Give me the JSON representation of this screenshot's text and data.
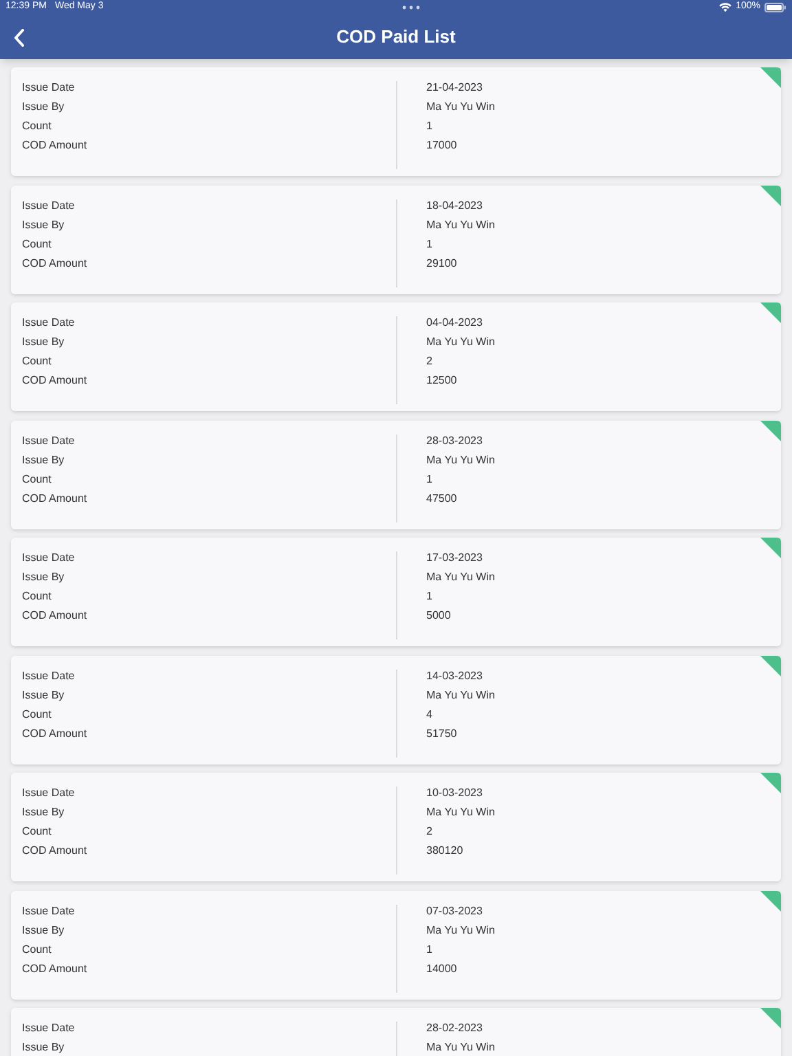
{
  "status_bar": {
    "time": "12:39 PM",
    "date": "Wed May 3",
    "battery": "100%"
  },
  "header": {
    "title": "COD Paid List"
  },
  "cards": [
    {
      "fields": [
        {
          "label": "Issue Date",
          "value": "21-04-2023"
        },
        {
          "label": "Issue By",
          "value": "Ma Yu Yu Win"
        },
        {
          "label": "Count",
          "value": "1"
        },
        {
          "label": "COD Amount",
          "value": "17000"
        }
      ]
    },
    {
      "fields": [
        {
          "label": "Issue Date",
          "value": "18-04-2023"
        },
        {
          "label": "Issue By",
          "value": "Ma Yu Yu Win"
        },
        {
          "label": "Count",
          "value": "1"
        },
        {
          "label": "COD Amount",
          "value": "29100"
        }
      ]
    },
    {
      "fields": [
        {
          "label": "Issue Date",
          "value": "04-04-2023"
        },
        {
          "label": "Issue By",
          "value": "Ma Yu Yu Win"
        },
        {
          "label": "Count",
          "value": "2"
        },
        {
          "label": "COD Amount",
          "value": "12500"
        }
      ]
    },
    {
      "fields": [
        {
          "label": "Issue Date",
          "value": "28-03-2023"
        },
        {
          "label": "Issue By",
          "value": "Ma Yu Yu Win"
        },
        {
          "label": "Count",
          "value": "1"
        },
        {
          "label": "COD Amount",
          "value": "47500"
        }
      ]
    },
    {
      "fields": [
        {
          "label": "Issue Date",
          "value": "17-03-2023"
        },
        {
          "label": "Issue By",
          "value": "Ma Yu Yu Win"
        },
        {
          "label": "Count",
          "value": "1"
        },
        {
          "label": "COD Amount",
          "value": "5000"
        }
      ]
    },
    {
      "fields": [
        {
          "label": "Issue Date",
          "value": "14-03-2023"
        },
        {
          "label": "Issue By",
          "value": "Ma Yu Yu Win"
        },
        {
          "label": "Count",
          "value": "4"
        },
        {
          "label": "COD Amount",
          "value": "51750"
        }
      ]
    },
    {
      "fields": [
        {
          "label": "Issue Date",
          "value": "10-03-2023"
        },
        {
          "label": "Issue By",
          "value": "Ma Yu Yu Win"
        },
        {
          "label": "Count",
          "value": "2"
        },
        {
          "label": "COD Amount",
          "value": "380120"
        }
      ]
    },
    {
      "fields": [
        {
          "label": "Issue Date",
          "value": "07-03-2023"
        },
        {
          "label": "Issue By",
          "value": "Ma Yu Yu Win"
        },
        {
          "label": "Count",
          "value": "1"
        },
        {
          "label": "COD Amount",
          "value": "14000"
        }
      ]
    },
    {
      "fields": [
        {
          "label": "Issue Date",
          "value": "28-02-2023"
        },
        {
          "label": "Issue By",
          "value": "Ma Yu Yu Win"
        }
      ]
    }
  ]
}
